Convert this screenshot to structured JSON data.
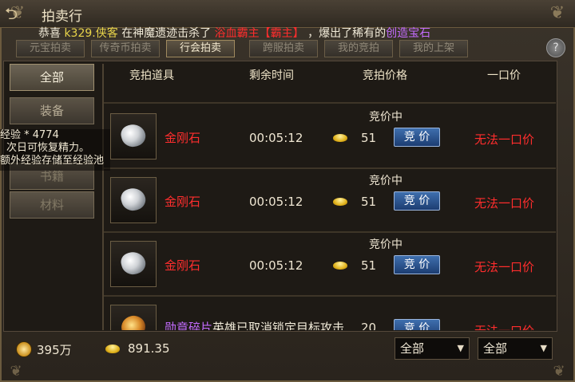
{
  "window": {
    "title": "拍卖行"
  },
  "announcement": {
    "prefix": "恭喜",
    "player": "k329.侠客",
    "middle": "在神魔遗迹击杀了",
    "boss": "浴血霸主【霸主】",
    "suffix": "，爆出了稀有的",
    "item": "创造宝石"
  },
  "tabs": [
    "元宝拍卖",
    "传奇币拍卖",
    "行会拍卖",
    "跨服拍卖",
    "我的竞拍",
    "我的上架"
  ],
  "active_tab": "行会拍卖",
  "categories": [
    {
      "label": "全部",
      "active": true
    },
    {
      "label": "装备",
      "active": false
    },
    {
      "label": "书籍",
      "active": false
    },
    {
      "label": "材料",
      "active": false
    }
  ],
  "exp_tooltip": {
    "line1": "经验 * 4774",
    "line2": "次日可恢复精力。",
    "line3": "额外经验存储至经验池"
  },
  "table": {
    "headers": [
      "竞拍道具",
      "剩余时间",
      "竞拍价格",
      "一口价"
    ],
    "rows": [
      {
        "name": "金刚石",
        "time": "00:05:12",
        "price": "51",
        "status": "竞价中",
        "bid": "竞 价",
        "buyout": "无法一口价"
      },
      {
        "name": "金刚石",
        "time": "00:05:12",
        "price": "51",
        "status": "竞价中",
        "bid": "竞 价",
        "buyout": "无法一口价"
      },
      {
        "name": "金刚石",
        "time": "00:05:12",
        "price": "51",
        "status": "竞价中",
        "bid": "竞 价",
        "buyout": "无法一口价"
      },
      {
        "name": "勋章碎片",
        "overlay": "英雄已取消锁定目标攻击",
        "time": "",
        "price": "20",
        "status": "",
        "bid": "竞 价",
        "buyout": "无法一口价"
      }
    ]
  },
  "currency": {
    "coins": "395万",
    "ingots": "891.35"
  },
  "filters": {
    "filter1": "全部",
    "filter2": "全部"
  },
  "colors": {
    "accent_red": "#ff2d2d",
    "accent_yellow": "#e8d44a",
    "accent_purple": "#c46cff",
    "button_blue": "#2a5596"
  },
  "icons": {
    "back": "back-arrow-icon",
    "help": "question-mark-icon",
    "coin": "coin-icon",
    "ingot": "gold-ingot-icon"
  }
}
